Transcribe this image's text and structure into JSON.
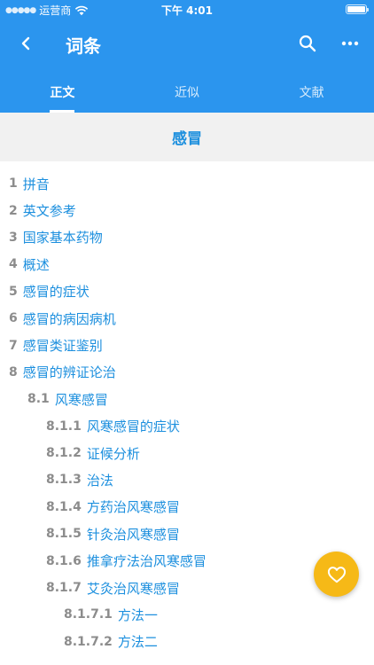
{
  "status_bar": {
    "carrier": "运营商",
    "time": "下午 4:01"
  },
  "nav": {
    "title": "词条"
  },
  "tabs": [
    {
      "label": "正文",
      "active": true
    },
    {
      "label": "近似",
      "active": false
    },
    {
      "label": "文献",
      "active": false
    }
  ],
  "page_title": "感冒",
  "toc": [
    {
      "num": "1",
      "label": "拼音",
      "level": 1
    },
    {
      "num": "2",
      "label": "英文参考",
      "level": 1
    },
    {
      "num": "3",
      "label": "国家基本药物",
      "level": 1
    },
    {
      "num": "4",
      "label": "概述",
      "level": 1
    },
    {
      "num": "5",
      "label": "感冒的症状",
      "level": 1
    },
    {
      "num": "6",
      "label": "感冒的病因病机",
      "level": 1
    },
    {
      "num": "7",
      "label": "感冒类证鉴别",
      "level": 1
    },
    {
      "num": "8",
      "label": "感冒的辨证论治",
      "level": 1
    },
    {
      "num": "8.1",
      "label": "风寒感冒",
      "level": 2
    },
    {
      "num": "8.1.1",
      "label": "风寒感冒的症状",
      "level": 3
    },
    {
      "num": "8.1.2",
      "label": "证候分析",
      "level": 3
    },
    {
      "num": "8.1.3",
      "label": "治法",
      "level": 3
    },
    {
      "num": "8.1.4",
      "label": "方药治风寒感冒",
      "level": 3
    },
    {
      "num": "8.1.5",
      "label": "针灸治风寒感冒",
      "level": 3
    },
    {
      "num": "8.1.6",
      "label": "推拿疗法治风寒感冒",
      "level": 3
    },
    {
      "num": "8.1.7",
      "label": "艾灸治风寒感冒",
      "level": 3
    },
    {
      "num": "8.1.7.1",
      "label": "方法一",
      "level": 4
    },
    {
      "num": "8.1.7.2",
      "label": "方法二",
      "level": 4
    }
  ],
  "colors": {
    "header": "#2b95ee",
    "link": "#1c8fde",
    "fav": "#f6b917"
  },
  "icons": {
    "back": "back-arrow-icon",
    "search": "search-icon",
    "more": "more-icon",
    "fav": "heart-icon"
  }
}
